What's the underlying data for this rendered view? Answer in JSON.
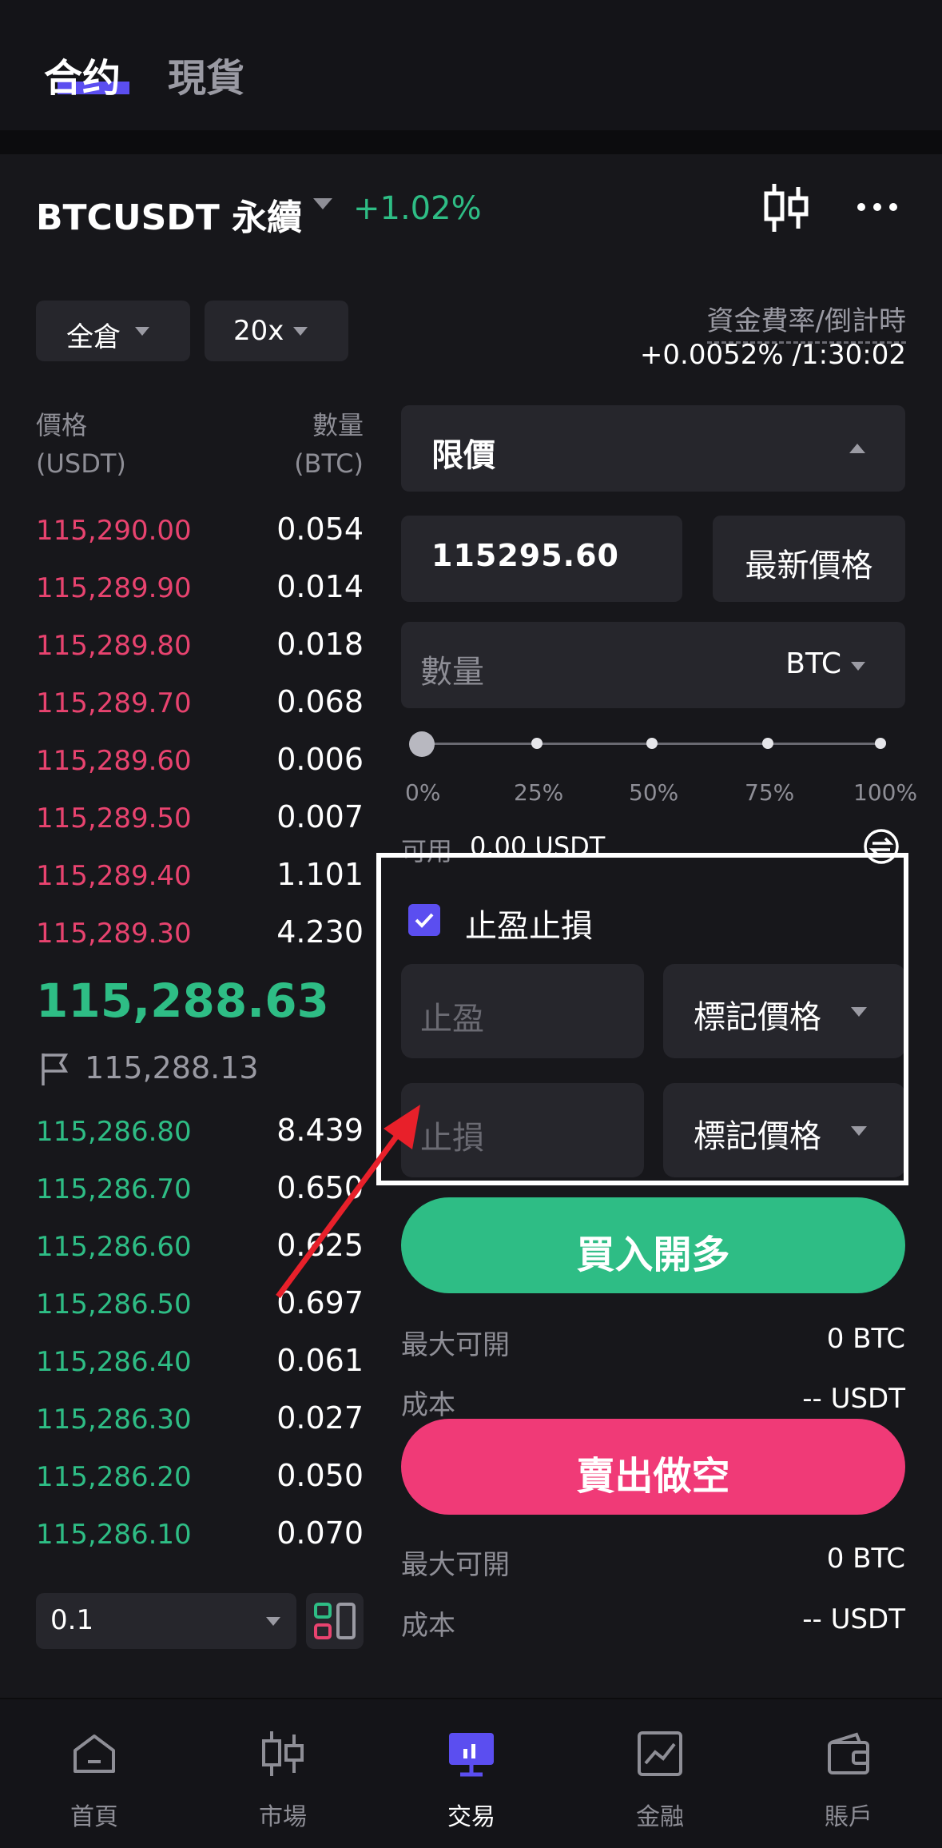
{
  "header": {
    "tabs": [
      {
        "label": "合约",
        "active": true
      },
      {
        "label": "現貨",
        "active": false
      }
    ]
  },
  "instrument": {
    "symbol": "BTCUSDT 永續",
    "change": "+1.02%",
    "icons": [
      "candlestick-icon",
      "more-icon"
    ]
  },
  "controls": {
    "margin_mode": "全倉",
    "leverage": "20x",
    "funding_label": "資金費率/倒計時",
    "funding_value": "+0.0052% /1:30:02"
  },
  "orderbook": {
    "price_head": "價格\n(USDT)",
    "qty_head": "數量\n(BTC)",
    "asks": [
      {
        "price": "115,290.00",
        "qty": "0.054"
      },
      {
        "price": "115,289.90",
        "qty": "0.014"
      },
      {
        "price": "115,289.80",
        "qty": "0.018"
      },
      {
        "price": "115,289.70",
        "qty": "0.068"
      },
      {
        "price": "115,289.60",
        "qty": "0.006"
      },
      {
        "price": "115,289.50",
        "qty": "0.007"
      },
      {
        "price": "115,289.40",
        "qty": "1.101"
      },
      {
        "price": "115,289.30",
        "qty": "4.230"
      }
    ],
    "last_price": "115,288.63",
    "mark_price": "115,288.13",
    "bids": [
      {
        "price": "115,286.80",
        "qty": "8.439"
      },
      {
        "price": "115,286.70",
        "qty": "0.650"
      },
      {
        "price": "115,286.60",
        "qty": "0.625"
      },
      {
        "price": "115,286.50",
        "qty": "0.697"
      },
      {
        "price": "115,286.40",
        "qty": "0.061"
      },
      {
        "price": "115,286.30",
        "qty": "0.027"
      },
      {
        "price": "115,286.20",
        "qty": "0.050"
      },
      {
        "price": "115,286.10",
        "qty": "0.070"
      }
    ],
    "depth": "0.1"
  },
  "order_form": {
    "order_type": "限價",
    "price": "115295.60",
    "latest_price_btn": "最新價格",
    "qty_placeholder": "數量",
    "qty_unit": "BTC",
    "slider_percent": 0,
    "slider_marks": [
      "0%",
      "25%",
      "50%",
      "75%",
      "100%"
    ],
    "available_label": "可用",
    "available_value": "0.00 USDT",
    "tpsl_label": "止盈止損",
    "tpsl_checked": true,
    "tp_placeholder": "止盈",
    "sl_placeholder": "止損",
    "tp_trigger": "標記價格",
    "sl_trigger": "標記價格",
    "buy_label": "買入開多",
    "buy_max_label": "最大可開",
    "buy_max_value": "0 BTC",
    "buy_cost_label": "成本",
    "buy_cost_value": "-- USDT",
    "sell_label": "賣出做空",
    "sell_max_label": "最大可開",
    "sell_max_value": "0 BTC",
    "sell_cost_label": "成本",
    "sell_cost_value": "-- USDT"
  },
  "colors": {
    "accent": "#5b4ef0",
    "buy": "#2ebd85",
    "sell": "#f03a77",
    "annotation_arrow": "#e8202a"
  },
  "bottom_nav": [
    {
      "label": "首頁",
      "icon": "home-icon"
    },
    {
      "label": "市場",
      "icon": "market-icon"
    },
    {
      "label": "交易",
      "icon": "trade-icon",
      "active": true
    },
    {
      "label": "金融",
      "icon": "finance-icon"
    },
    {
      "label": "賬戶",
      "icon": "wallet-icon"
    }
  ]
}
